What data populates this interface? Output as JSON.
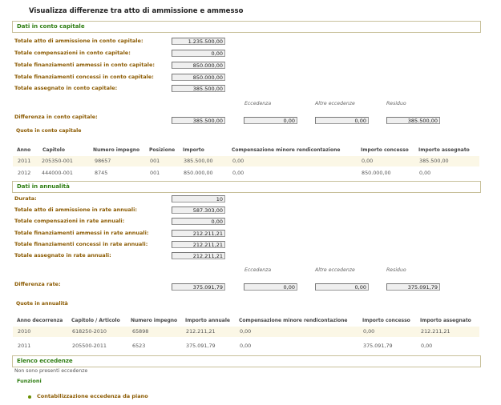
{
  "page_title": "Visualizza differenze tra atto di ammissione e ammesso",
  "capitale": {
    "section_title": "Dati in conto capitale",
    "rows": [
      {
        "label": "Totale atto di ammissione in conto capitale:",
        "value": "1.235.500,00"
      },
      {
        "label": "Totale compensazioni  in conto capitale:",
        "value": "0,00"
      },
      {
        "label": "Totale finanziamenti ammessi in conto capitale:",
        "value": "850.000,00"
      },
      {
        "label": "Totale finanziamenti concessi in conto capitale:",
        "value": "850.000,00"
      },
      {
        "label": "Totale assegnato in conto capitale:",
        "value": "385.500,00"
      }
    ],
    "diff_headers": [
      "Eccedenza",
      "Altre eccedenze",
      "Residuo"
    ],
    "diff_label": "Differenza in conto capitale:",
    "diff_values": [
      "385.500,00",
      "0,00",
      "0,00",
      "385.500,00"
    ],
    "quote_title": "Quote in conto capitale",
    "table_headers": [
      "Anno",
      "Capitolo",
      "Numero impegno",
      "Posizione",
      "Importo",
      "Compensazione minore rendicontazione",
      "Importo concesso",
      "Importo assegnato"
    ],
    "table_rows": [
      [
        "2011",
        "205350-001",
        "98657",
        "001",
        "385.500,00",
        "0,00",
        "0,00",
        "385.500,00"
      ],
      [
        "2012",
        "444000-001",
        "8745",
        "001",
        "850.000,00",
        "0,00",
        "850.000,00",
        "0,00"
      ]
    ]
  },
  "annualita": {
    "section_title": "Dati in annualità",
    "rows": [
      {
        "label": "Durata:",
        "value": "10"
      },
      {
        "label": "Totale atto di ammissione in rate annuali:",
        "value": "587.303,00"
      },
      {
        "label": "Totale compensazioni in rate annuali:",
        "value": "0,00"
      },
      {
        "label": "Totale finanziamenti ammessi in rate annuali:",
        "value": "212.211,21"
      },
      {
        "label": "Totale finanziamenti concessi in rate annuali:",
        "value": "212.211,21"
      },
      {
        "label": "Totale assegnato in rate annuali:",
        "value": "212.211,21"
      }
    ],
    "diff_headers": [
      "Eccedenza",
      "Altre eccedenze",
      "Residuo"
    ],
    "diff_label": "Differenza rate:",
    "diff_values": [
      "375.091,79",
      "0,00",
      "0,00",
      "375.091,79"
    ],
    "quote_title": "Quote in annualità",
    "table_headers": [
      "Anno decorrenza",
      "Capitolo / Articolo",
      "Numero impegno",
      "Importo annuale",
      "Compensazione minore rendicontazione",
      "Importo concesso",
      "Importo assegnato"
    ],
    "table_rows": [
      [
        "2010",
        "618250-2010",
        "65898",
        "212.211,21",
        "0,00",
        "0,00",
        "212.211,21"
      ],
      [
        "2011",
        "205500-2011",
        "6523",
        "375.091,79",
        "0,00",
        "375.091,79",
        "0,00"
      ]
    ]
  },
  "eccedenze": {
    "section_title": "Elenco eccedenze",
    "empty_note": "Non sono presenti eccedenze",
    "funzioni_title": "Funzioni",
    "link_label": "Contabilizzazione eccedenza da piano"
  }
}
